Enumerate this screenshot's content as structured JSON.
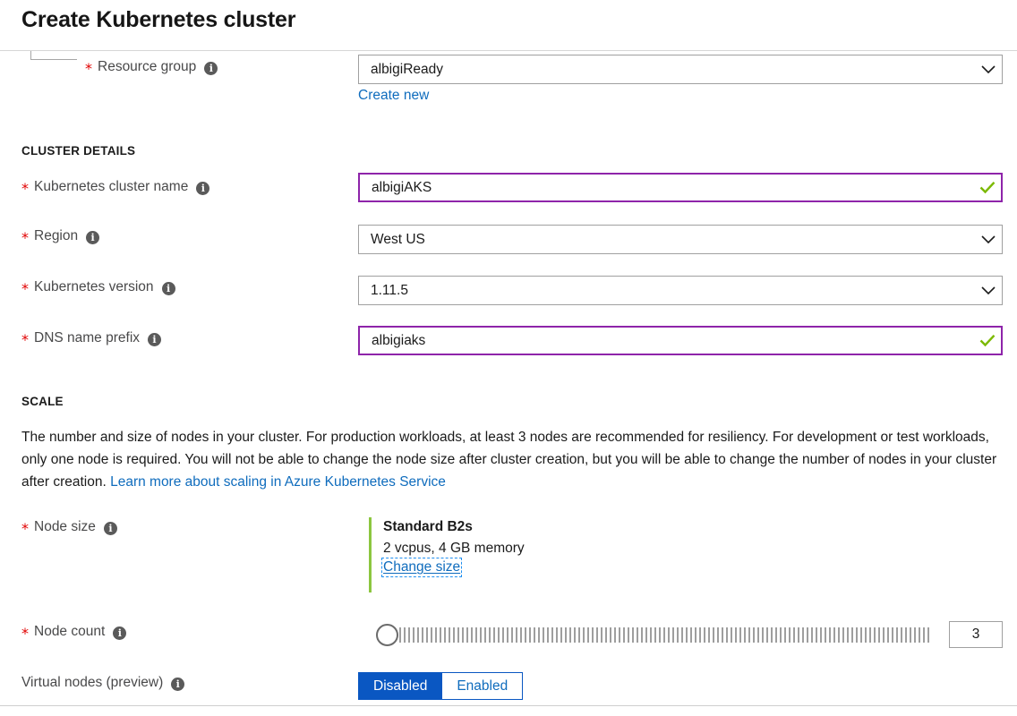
{
  "blade": {
    "title": "Create Kubernetes cluster"
  },
  "resource_group": {
    "label": "Resource group",
    "required": true,
    "info_icon": "info-icon",
    "value": "albigiReady",
    "dropdown_icon": "chevron-down-icon",
    "create_new_link": "Create new"
  },
  "cluster_details": {
    "heading": "CLUSTER DETAILS",
    "fields": [
      {
        "name": "kubernetes-cluster-name",
        "label": "Kubernetes cluster name",
        "required": true,
        "value": "albigiAKS",
        "control": "text",
        "state": "valid",
        "status_icon": "check-icon"
      },
      {
        "name": "region",
        "label": "Region",
        "required": true,
        "value": "West US",
        "control": "dropdown",
        "state": "normal",
        "status_icon": "chevron-down-icon"
      },
      {
        "name": "kubernetes-version",
        "label": "Kubernetes version",
        "required": true,
        "value": "1.11.5",
        "control": "dropdown",
        "state": "normal",
        "status_icon": "chevron-down-icon"
      },
      {
        "name": "dns-name-prefix",
        "label": "DNS name prefix",
        "required": true,
        "value": "albigiaks",
        "control": "text",
        "state": "valid",
        "status_icon": "check-icon"
      }
    ]
  },
  "scale": {
    "heading": "SCALE",
    "description": "The number and size of nodes in your cluster. For production workloads, at least 3 nodes are recommended for resiliency. For development or test workloads, only one node is required. You will not be able to change the node size after cluster creation, but you will be able to change the number of nodes in your cluster after creation. ",
    "learn_more_link": "Learn more about scaling in Azure Kubernetes Service",
    "node_size": {
      "label": "Node size",
      "required": true,
      "title": "Standard B2s",
      "specs": "2 vcpus, 4 GB memory",
      "change_link": "Change size",
      "accent_color": "#8cc63f"
    },
    "node_count": {
      "label": "Node count",
      "required": true,
      "value": "3",
      "slider_position": "min"
    },
    "virtual_nodes": {
      "label": "Virtual nodes (preview)",
      "required": false,
      "options": [
        "Disabled",
        "Enabled"
      ],
      "selected": "Disabled"
    }
  },
  "colors": {
    "accent_blue": "#0a57c2",
    "link_blue": "#0f6cbd",
    "valid_purple": "#8e24aa",
    "check_green": "#7bb900",
    "required_red": "#e10000",
    "node_accent_green": "#8cc63f"
  }
}
